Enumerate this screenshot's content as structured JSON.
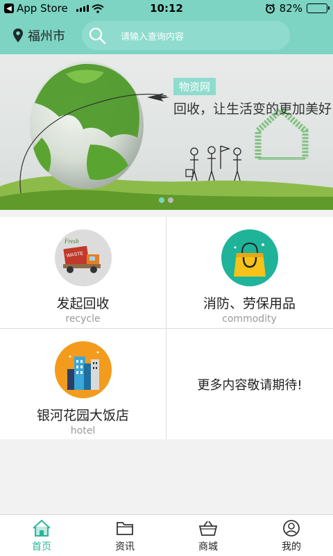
{
  "status_bar": {
    "carrier": "App Store",
    "time": "10:12",
    "battery": "82%",
    "battery_level": 0.82
  },
  "header": {
    "location": "福州市",
    "search_placeholder": "请输入查询内容"
  },
  "banner": {
    "tag": "物资网",
    "slogan": "回收，让生活变的更加美好",
    "page_count": 2,
    "active_page": 1
  },
  "services": [
    {
      "title": "发起回收",
      "subtitle": "recycle",
      "icon": "recycle-truck-icon"
    },
    {
      "title": "消防、劳保用品",
      "subtitle": "commodity",
      "icon": "shopping-bag-icon"
    },
    {
      "title": "银河花园大饭店",
      "subtitle": "hotel",
      "icon": "hotel-buildings-icon"
    }
  ],
  "more_text": "更多内容敬请期待!",
  "tabs": [
    {
      "label": "首页",
      "icon": "home-icon",
      "active": true
    },
    {
      "label": "资讯",
      "icon": "folder-icon",
      "active": false
    },
    {
      "label": "商城",
      "icon": "basket-icon",
      "active": false
    },
    {
      "label": "我的",
      "icon": "user-icon",
      "active": false
    }
  ],
  "colors": {
    "accent": "#7dd4c3",
    "tab_active": "#2bb59a"
  }
}
